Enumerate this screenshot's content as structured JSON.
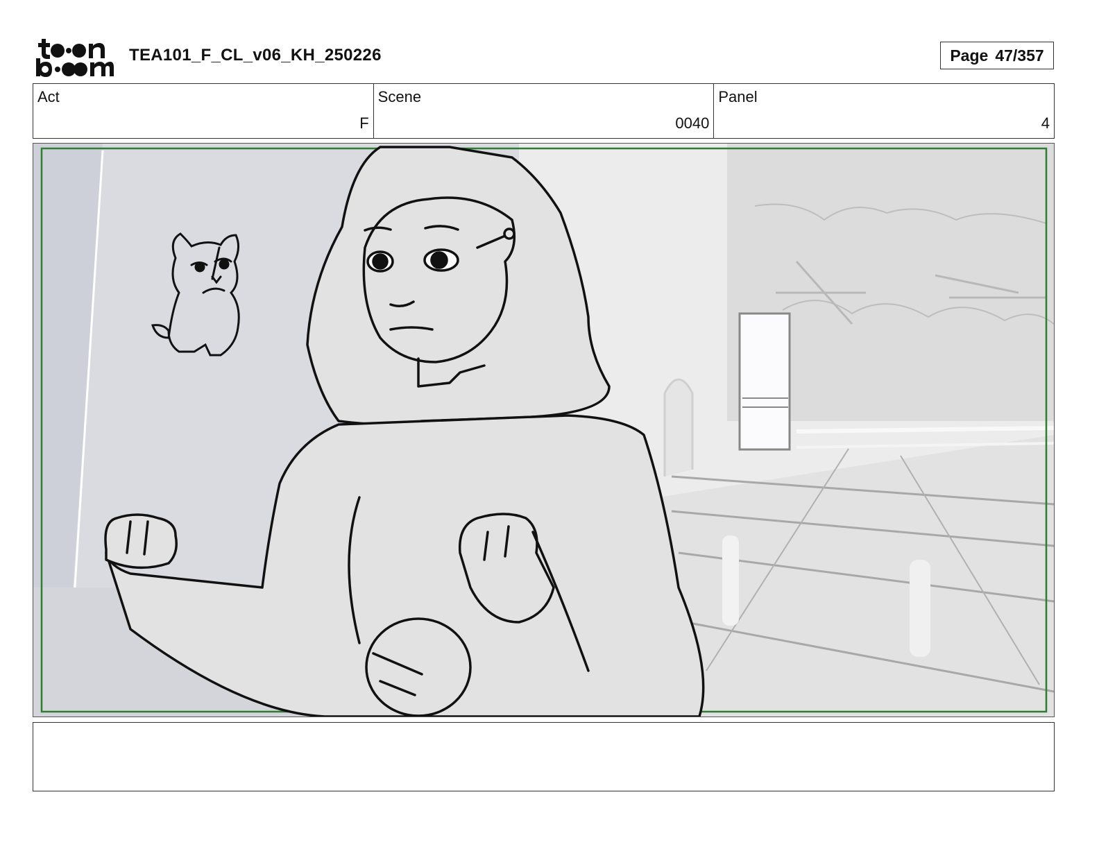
{
  "header": {
    "logo_alt": "toon boom",
    "document_title": "TEA101_F_CL_v06_KH_250226",
    "page_word": "Page",
    "page_number": "47/357"
  },
  "info": {
    "act_label": "Act",
    "act_value": "F",
    "scene_label": "Scene",
    "scene_value": "0040",
    "panel_label": "Panel",
    "panel_value": "4"
  },
  "panel": {
    "image": "storyboard-sketch-girl-with-fists-and-small-cat-creature-in-courtyard",
    "safe_frame_color": "#2e7d32"
  },
  "notes": {
    "text": ""
  }
}
